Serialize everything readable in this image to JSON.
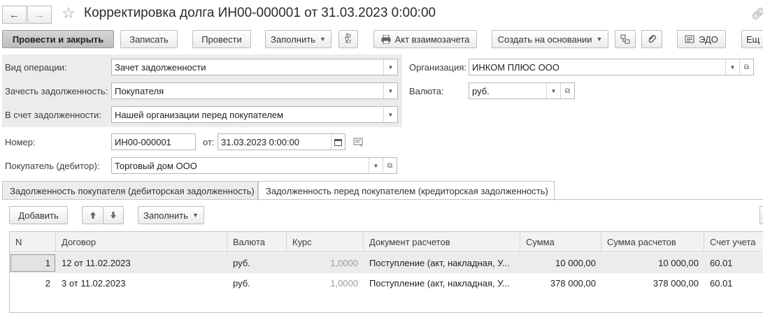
{
  "header": {
    "title": "Корректировка долга ИН00-000001 от 31.03.2023 0:00:00"
  },
  "toolbar": {
    "post_close": "Провести и закрыть",
    "write": "Записать",
    "post": "Провести",
    "fill": "Заполнить",
    "dtkt": "Дт\nКт",
    "act": "Акт взаимозачета",
    "create_based": "Создать на основании",
    "edo": "ЭДО",
    "more": "Ещ"
  },
  "form": {
    "op_type_label": "Вид операции:",
    "op_type_value": "Зачет задолженности",
    "offset_label": "Зачесть задолженность:",
    "offset_value": "Покупателя",
    "to_label": "В счет задолженности:",
    "to_value": "Нашей организации перед покупателем",
    "org_label": "Организация:",
    "org_value": "ИНКОМ ПЛЮС ООО",
    "currency_label": "Валюта:",
    "currency_value": "руб.",
    "number_label": "Номер:",
    "number_value": "ИН00-000001",
    "from_label": "от:",
    "date_value": "31.03.2023  0:00:00",
    "buyer_label": "Покупатель (дебитор):",
    "buyer_value": "Торговый дом ООО"
  },
  "tabs": [
    {
      "label": "Задолженность покупателя (дебиторская задолженность)",
      "active": false
    },
    {
      "label": "Задолженность перед покупателем (кредиторская задолженность)",
      "active": true
    }
  ],
  "table_toolbar": {
    "add": "Добавить",
    "fill": "Заполнить"
  },
  "table": {
    "columns": [
      "N",
      "Договор",
      "Валюта",
      "Курс",
      "Документ расчетов",
      "Сумма",
      "Сумма расчетов",
      "Счет учета"
    ],
    "rows": [
      {
        "n": "1",
        "contract": "12 от 11.02.2023",
        "currency": "руб.",
        "rate": "1,0000",
        "doc": "Поступление (акт, накладная, У...",
        "sum": "10 000,00",
        "settle": "10 000,00",
        "account": "60.01"
      },
      {
        "n": "2",
        "contract": "3 от 11.02.2023",
        "currency": "руб.",
        "rate": "1,0000",
        "doc": "Поступление (акт, накладная, У...",
        "sum": "378 000,00",
        "settle": "378 000,00",
        "account": "60.01"
      }
    ]
  }
}
